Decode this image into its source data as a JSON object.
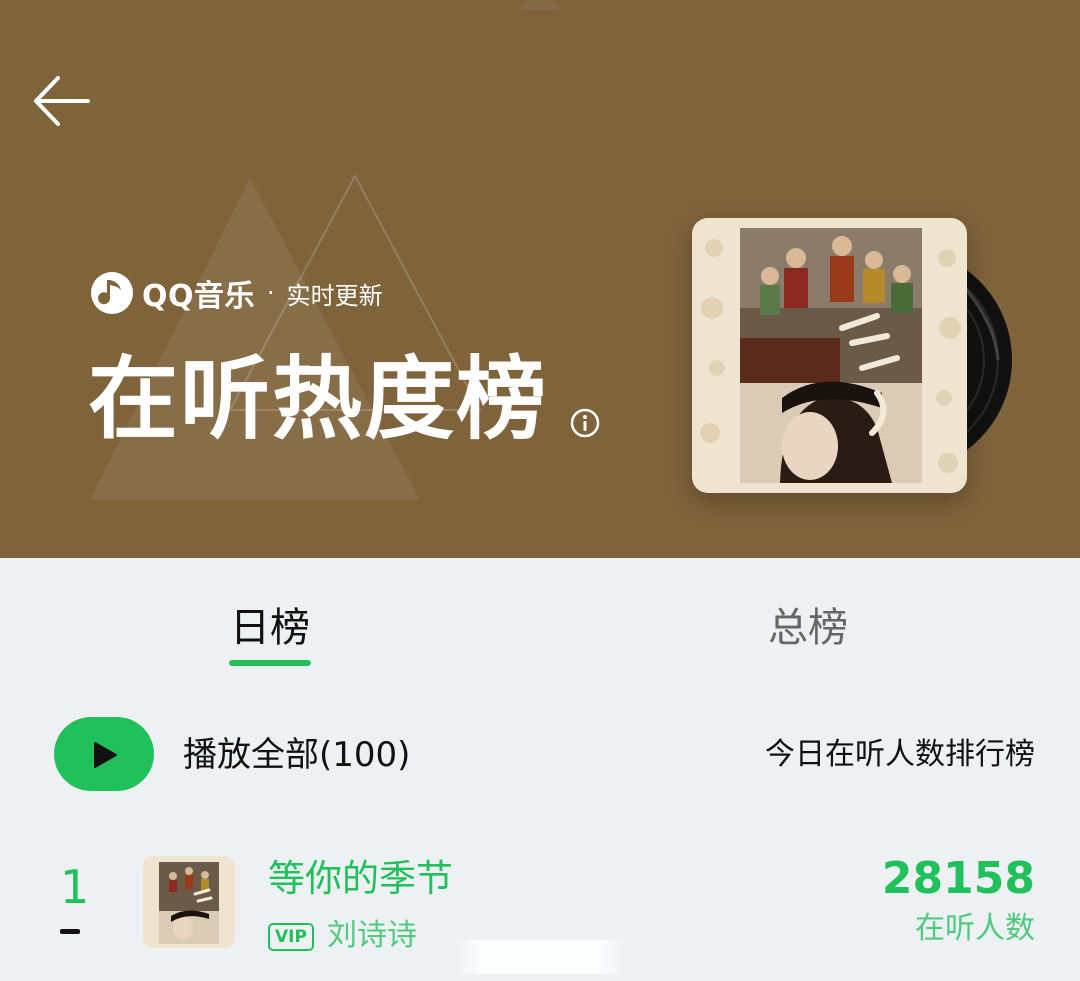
{
  "header": {
    "brand_name": "QQ音乐",
    "separator": "·",
    "brand_subtitle": "实时更新",
    "title": "在听热度榜",
    "background_color": "#7e633b"
  },
  "tabs": [
    {
      "label": "日榜",
      "active": true
    },
    {
      "label": "总榜",
      "active": false
    }
  ],
  "toolbar": {
    "play_all_label": "播放全部(100)",
    "ranking_label": "今日在听人数排行榜"
  },
  "songs": [
    {
      "rank": "1",
      "title": "等你的季节",
      "badge": "VIP",
      "artist": "刘诗诗",
      "listeners": "28158",
      "listeners_label": "在听人数"
    }
  ],
  "icons": {
    "back": "arrow-left-icon",
    "info": "info-icon",
    "play": "play-icon",
    "logo": "qq-music-logo-icon"
  },
  "colors": {
    "accent": "#20c05a",
    "header_bg": "#7e633b",
    "page_bg": "#eef1f4"
  }
}
